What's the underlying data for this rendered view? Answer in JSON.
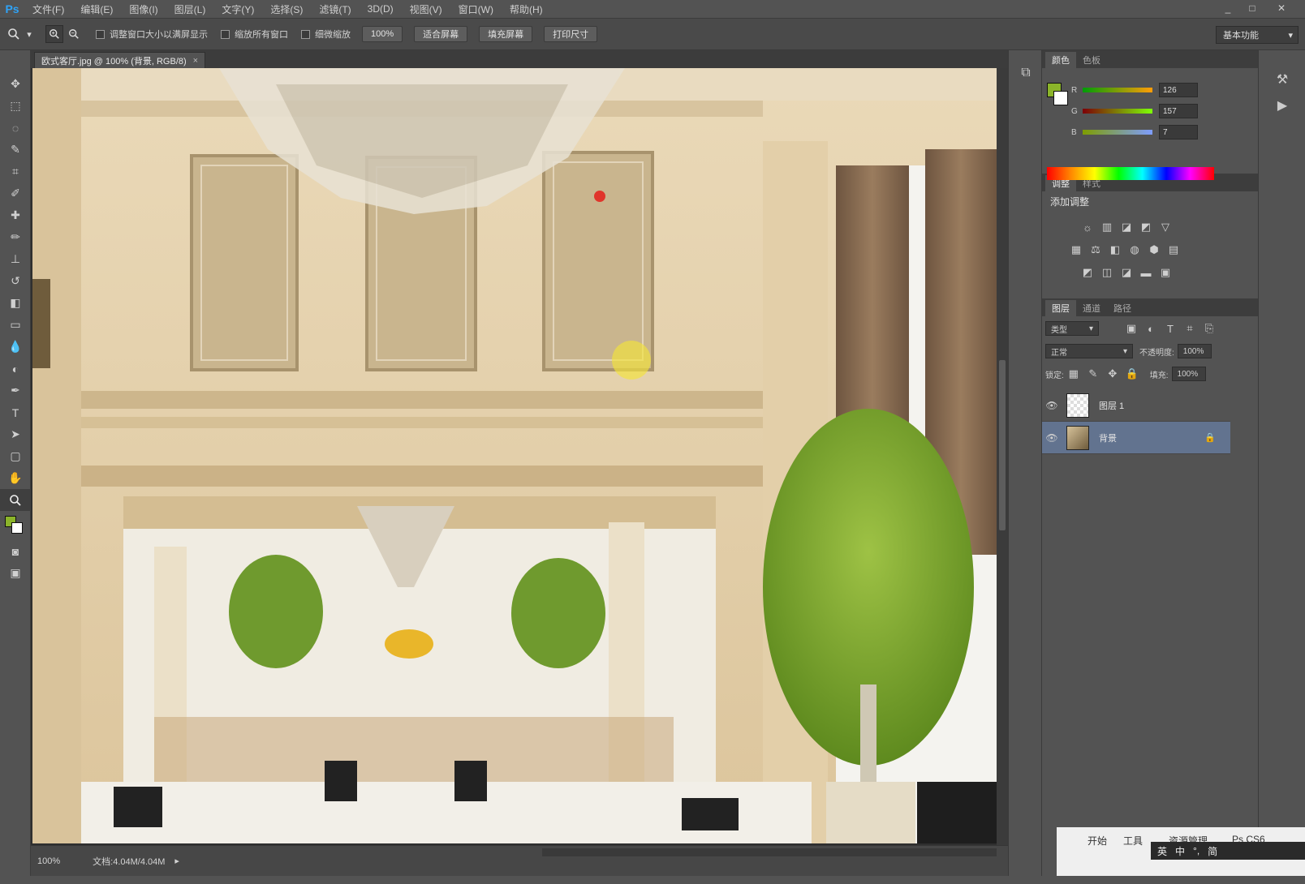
{
  "app": {
    "logo": "Ps"
  },
  "menu": [
    "文件(F)",
    "编辑(E)",
    "图像(I)",
    "图层(L)",
    "文字(Y)",
    "选择(S)",
    "滤镜(T)",
    "3D(D)",
    "视图(V)",
    "窗口(W)",
    "帮助(H)"
  ],
  "window_controls": [
    "_",
    "□",
    "✕"
  ],
  "options": {
    "checks": [
      "调整窗口大小以满屏显示",
      "缩放所有窗口",
      "细微缩放"
    ],
    "buttons": [
      "100%",
      "适合屏幕",
      "填充屏幕",
      "打印尺寸"
    ],
    "workspace": "基本功能"
  },
  "document": {
    "tab_label": "欧式客厅.jpg @ 100% (背景, RGB/8)",
    "close": "×"
  },
  "status": {
    "zoom": "100%",
    "doc_info": "文档:4.04M/4.04M"
  },
  "color_panel": {
    "tabs": [
      "颜色",
      "色板"
    ],
    "channels": [
      {
        "label": "R",
        "value": "126"
      },
      {
        "label": "G",
        "value": "157"
      },
      {
        "label": "B",
        "value": "7"
      }
    ],
    "foreground": "#8bb42a",
    "background": "#ffffff"
  },
  "adjustments_panel": {
    "tabs": [
      "调整",
      "样式"
    ],
    "title": "添加调整"
  },
  "layers_panel": {
    "tabs": [
      "图层",
      "通道",
      "路径"
    ],
    "kind": "类型",
    "blend_mode": "正常",
    "opacity_label": "不透明度:",
    "opacity": "100%",
    "lock_label": "锁定:",
    "fill_label": "填充:",
    "fill": "100%",
    "layers": [
      {
        "name": "图层 1",
        "selected": false
      },
      {
        "name": "背景",
        "selected": true
      }
    ]
  },
  "taskbar": {
    "items": [
      "开始",
      "工具",
      "资源管理",
      "Ps CS6"
    ],
    "ime": [
      "英",
      "中",
      "°,",
      "简"
    ]
  }
}
